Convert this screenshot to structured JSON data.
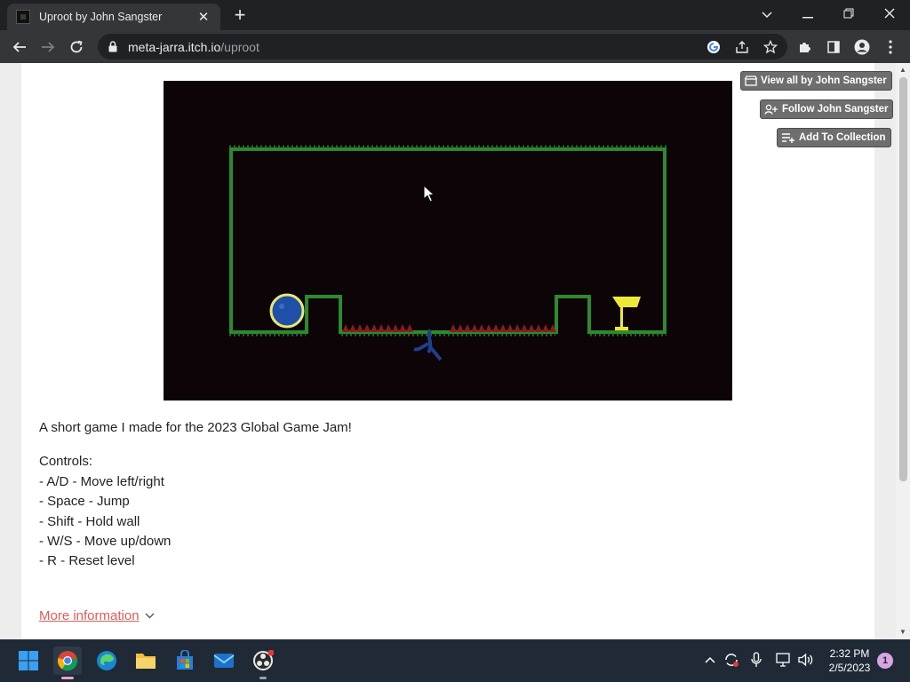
{
  "browser": {
    "tab": {
      "title": "Uproot by John Sangster"
    },
    "address": {
      "host": "meta-jarra.itch.io",
      "path": "/uproot"
    }
  },
  "page": {
    "buttons": {
      "view_all": "View all by John Sangster",
      "follow": "Follow John Sangster",
      "add_collection": "Add To Collection"
    },
    "description": {
      "intro": "A short game I made for the 2023 Global Game Jam!",
      "controls_heading": "Controls:",
      "controls": [
        "- A/D - Move left/right",
        "- Space - Jump",
        "- Shift - Hold wall",
        "- W/S - Move up/down",
        "- R - Reset level"
      ]
    },
    "more_info": "More information"
  },
  "game": {
    "colors": {
      "background": "#0c0407",
      "wall": "#2d8a2d",
      "spikes": "#8a1a20",
      "player": "#1f4fa6",
      "goal": "#f0e838"
    }
  },
  "taskbar": {
    "time": "2:32 PM",
    "date": "2/5/2023",
    "notification_count": "1",
    "apps": [
      "windows-start-icon",
      "chrome-icon",
      "edge-icon",
      "file-explorer-icon",
      "microsoft-store-icon",
      "mail-icon",
      "obs-icon"
    ]
  }
}
